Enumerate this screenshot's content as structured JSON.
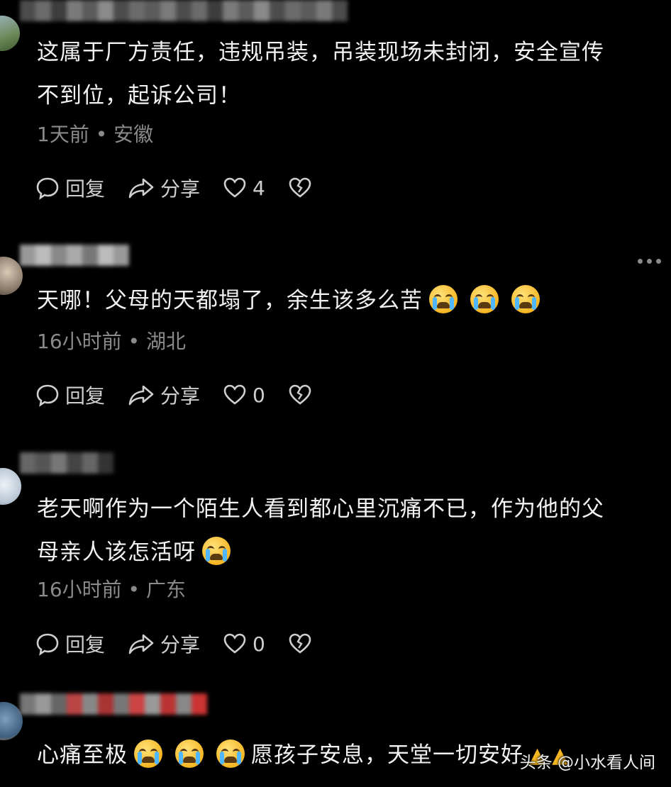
{
  "comments": [
    {
      "text_lines": [
        "这属于厂方责任，违规吊装，吊装现场未封闭，安全宣传",
        "不到位，起诉公司！"
      ],
      "meta": "1天前 • 安徽",
      "reply": "回复",
      "share": "分享",
      "likes": "4"
    },
    {
      "text": "天哪！父母的天都塌了，余生该多么苦",
      "meta": "16小时前 • 湖北",
      "reply": "回复",
      "share": "分享",
      "likes": "0"
    },
    {
      "text_lines": [
        "老天啊作为一个陌生人看到都心里沉痛不已，作为他的父",
        "母亲人该怎活呀"
      ],
      "meta": "16小时前 • 广东",
      "reply": "回复",
      "share": "分享",
      "likes": "0"
    },
    {
      "text_a": "心痛至极",
      "text_b": "愿孩子安息，天堂一切安好"
    }
  ],
  "watermark": "头条 @小水看人间",
  "colors": {
    "background": "#000000",
    "meta_text": "#8a8a8a",
    "emoji": "#f5b623"
  },
  "icons": [
    "comment-bubble-icon",
    "share-arrow-icon",
    "heart-icon",
    "broken-heart-icon",
    "crying-face-emoji",
    "praying-hands-emoji",
    "more-dots-icon"
  ]
}
